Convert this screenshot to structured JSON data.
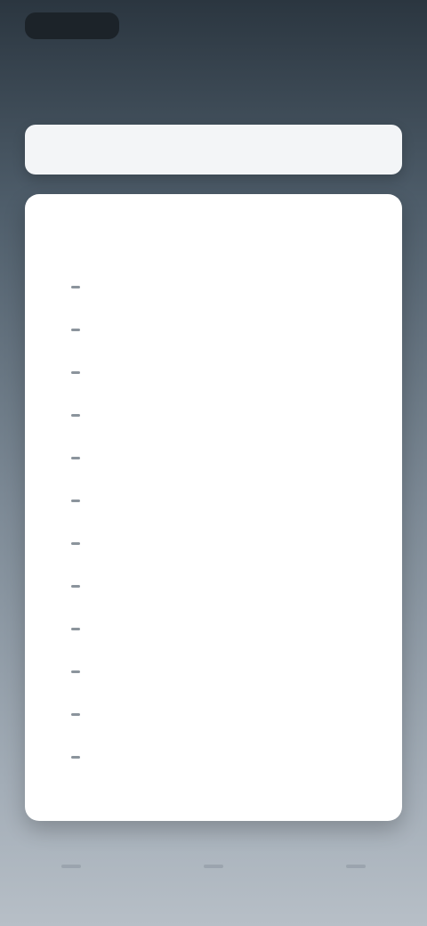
{
  "header": {
    "title": ""
  },
  "search": {
    "placeholder": ""
  },
  "list_card": {
    "heading": "",
    "items": [
      {
        "label": ""
      },
      {
        "label": ""
      },
      {
        "label": ""
      },
      {
        "label": ""
      },
      {
        "label": ""
      },
      {
        "label": ""
      },
      {
        "label": ""
      },
      {
        "label": ""
      },
      {
        "label": ""
      },
      {
        "label": ""
      },
      {
        "label": ""
      },
      {
        "label": ""
      }
    ]
  },
  "bottom_nav": {
    "icons": [
      "back-icon",
      "home-icon",
      "recents-icon"
    ]
  },
  "colors": {
    "background_top": "#2b3640",
    "background_bottom": "#b7bfc7",
    "card": "#ffffff",
    "search_bar": "#f3f5f7"
  }
}
